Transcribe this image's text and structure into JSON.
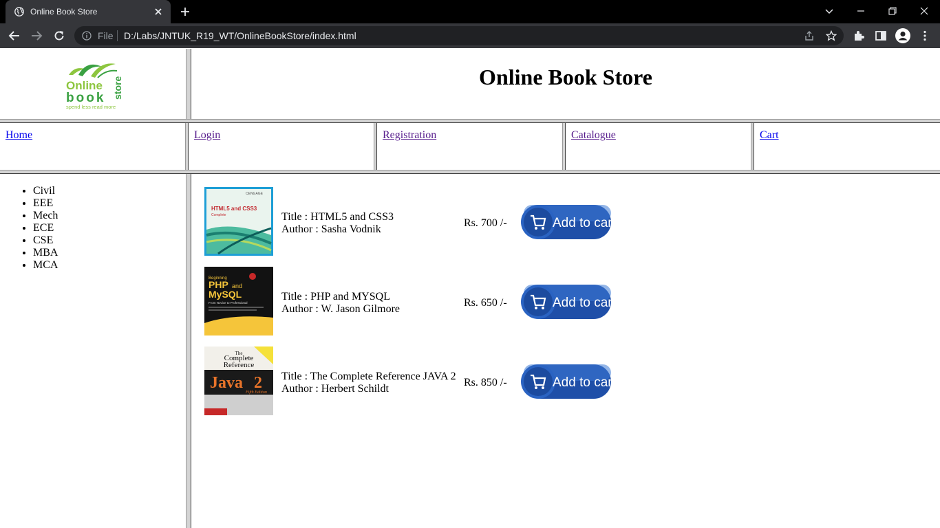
{
  "browser": {
    "tab_title": "Online Book Store",
    "file_label": "File",
    "url": "D:/Labs/JNTUK_R19_WT/OnlineBookStore/index.html"
  },
  "header": {
    "logo": {
      "line1": "Online",
      "line2": "book",
      "line3": "store",
      "tagline": "spend less read more"
    },
    "title": "Online Book Store"
  },
  "nav": {
    "items": [
      {
        "label": "Home"
      },
      {
        "label": "Login"
      },
      {
        "label": "Registration"
      },
      {
        "label": "Catalogue"
      },
      {
        "label": "Cart"
      }
    ]
  },
  "sidebar": {
    "departments": [
      "Civil",
      "EEE",
      "Mech",
      "ECE",
      "CSE",
      "MBA",
      "MCA"
    ]
  },
  "books": [
    {
      "title": "Title : HTML5 and CSS3",
      "author": "Author : Sasha Vodnik",
      "price": "Rs. 700 /-",
      "cover": {
        "publisher": "CENGAGE",
        "text": "HTML5 and CSS3",
        "sub": "Complete"
      }
    },
    {
      "title": "Title : PHP and MYSQL",
      "author": "Author : W. Jason Gilmore",
      "price": "Rs. 650 /-",
      "cover": {
        "top": "Beginning",
        "text1": "PHP",
        "and": "and",
        "text2": "MySQL",
        "sub": "From Novice to Professional"
      }
    },
    {
      "title": "Title : The Complete Reference JAVA 2",
      "author": "Author : Herbert Schildt",
      "price": "Rs. 850 /-",
      "cover": {
        "top1": "The",
        "top2": "Complete",
        "top3": "Reference",
        "text": "Java",
        "num": "2",
        "sub": "Fifth Edition"
      }
    }
  ],
  "cart_button_label": "Add to cart",
  "colors": {
    "browser_bg": "#000000",
    "toolbar_bg": "#35363a",
    "omnibox_bg": "#202124",
    "link": "#0000ee",
    "visited_link": "#551a8b",
    "cart_button": "#1f4fa8",
    "logo_green": "#8dc63f",
    "logo_dark_green": "#3aa142"
  }
}
